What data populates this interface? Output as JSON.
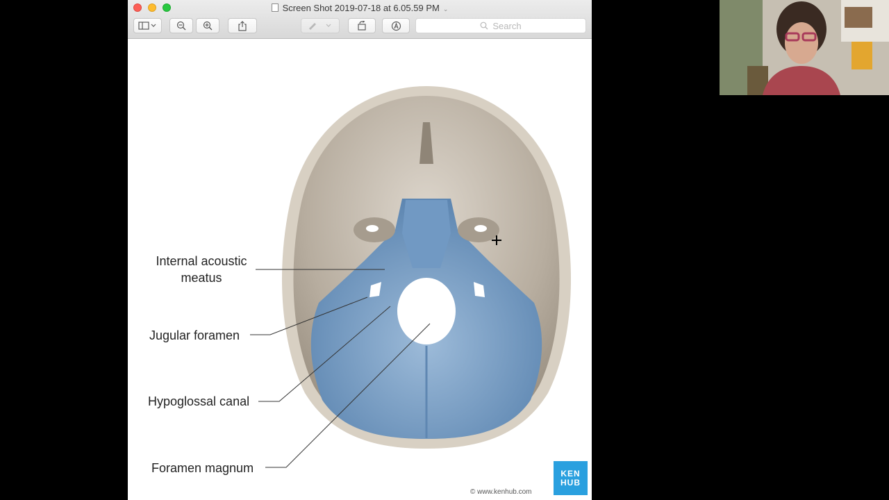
{
  "window": {
    "title": "Screen Shot 2019-07-18 at 6.05.59 PM",
    "toolbar": {
      "search_placeholder": "Search",
      "icons": [
        "sidebar-icon",
        "zoom-out-icon",
        "zoom-in-icon",
        "share-icon",
        "markup-pen-icon",
        "rotate-icon",
        "annotate-icon"
      ]
    }
  },
  "figure": {
    "labels": {
      "internal_acoustic_meatus": "Internal acoustic\nmeatus",
      "jugular_foramen": "Jugular foramen",
      "hypoglossal_canal": "Hypoglossal canal",
      "foramen_magnum": "Foramen magnum"
    },
    "logo_line1": "KEN",
    "logo_line2": "HUB",
    "credit": "© www.kenhub.com",
    "colors": {
      "highlight": "#6b93bd",
      "bone": "#bdb4a8",
      "logo": "#2aa0df"
    }
  }
}
